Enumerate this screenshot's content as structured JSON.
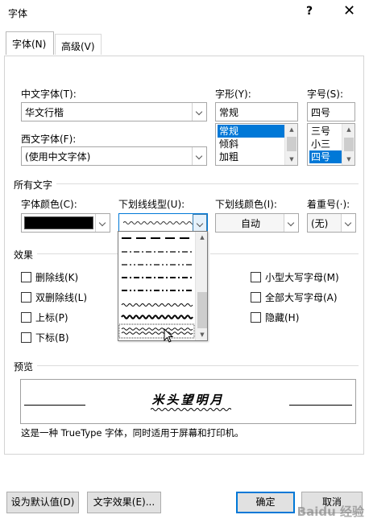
{
  "window": {
    "title": "字体",
    "help_glyph": "?",
    "close_glyph": "✕"
  },
  "tabs": [
    {
      "label": "字体(N)",
      "active": true
    },
    {
      "label": "高级(V)",
      "active": false
    }
  ],
  "fonts": {
    "cn_font_label": "中文字体(T):",
    "cn_font_value": "华文行楷",
    "west_font_label": "西文字体(F):",
    "west_font_value": "(使用中文字体)",
    "style_label": "字形(Y):",
    "style_value": "常规",
    "style_options": [
      "常规",
      "倾斜",
      "加粗"
    ],
    "size_label": "字号(S):",
    "size_value": "四号",
    "size_options": [
      "三号",
      "小三",
      "四号"
    ]
  },
  "all_text": {
    "section_label": "所有文字",
    "color_label": "字体颜色(C):",
    "color_value": "#000000",
    "underline_label": "下划线线型(U):",
    "underline_color_label": "下划线颜色(I):",
    "underline_color_value": "自动",
    "emphasis_label": "着重号(·):",
    "emphasis_value": "(无)"
  },
  "effects": {
    "section_label": "效果",
    "items": [
      {
        "label": "删除线(K)",
        "checked": false
      },
      {
        "label": "双删除线(L)",
        "checked": false
      },
      {
        "label": "上标(P)",
        "checked": false
      },
      {
        "label": "下标(B)",
        "checked": false
      },
      {
        "label": "小型大写字母(M)",
        "checked": false
      },
      {
        "label": "全部大写字母(A)",
        "checked": false
      },
      {
        "label": "隐藏(H)",
        "checked": false
      }
    ]
  },
  "preview": {
    "section_label": "预览",
    "sample_text": "米头望明月",
    "note": "这是一种 TrueType 字体，同时适用于屏幕和打印机。"
  },
  "buttons": {
    "set_default": "设为默认值(D)",
    "text_effects": "文字效果(E)...",
    "ok": "确定",
    "cancel": "取消"
  },
  "watermark": "Baidu 经验",
  "colors": {
    "accent": "#0078d7",
    "selection": "#0078d7"
  },
  "icons": {
    "close": "close-icon",
    "help": "help-icon",
    "chevron": "chevron-down-icon",
    "cursor": "cursor-icon"
  }
}
